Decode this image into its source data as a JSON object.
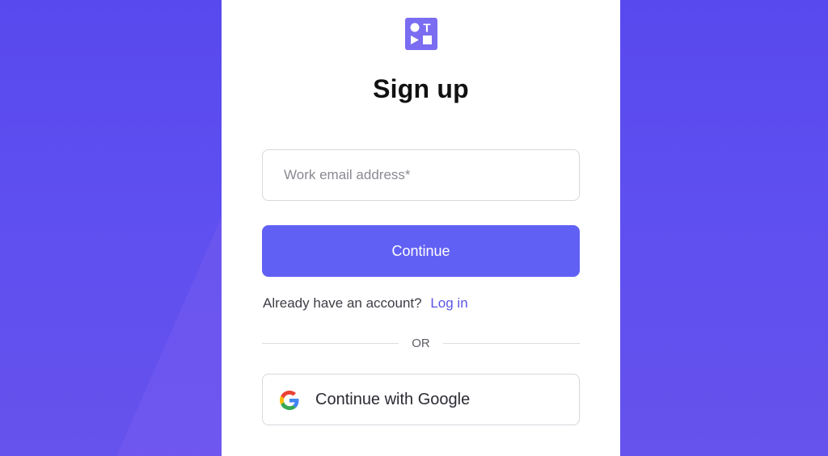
{
  "colors": {
    "background": "#5849ee",
    "card": "#ffffff",
    "primary": "#6160f4",
    "link": "#5b55e3",
    "logo": "#7a6df1"
  },
  "logo": {
    "icon": "shapes-logo-icon",
    "letter": "T"
  },
  "signup": {
    "title": "Sign up",
    "email_placeholder": "Work email address*",
    "email_value": "",
    "continue_label": "Continue",
    "login_prompt": "Already have an account?",
    "login_link": "Log in",
    "divider_text": "OR",
    "google_icon": "google-icon",
    "google_label": "Continue with Google"
  }
}
